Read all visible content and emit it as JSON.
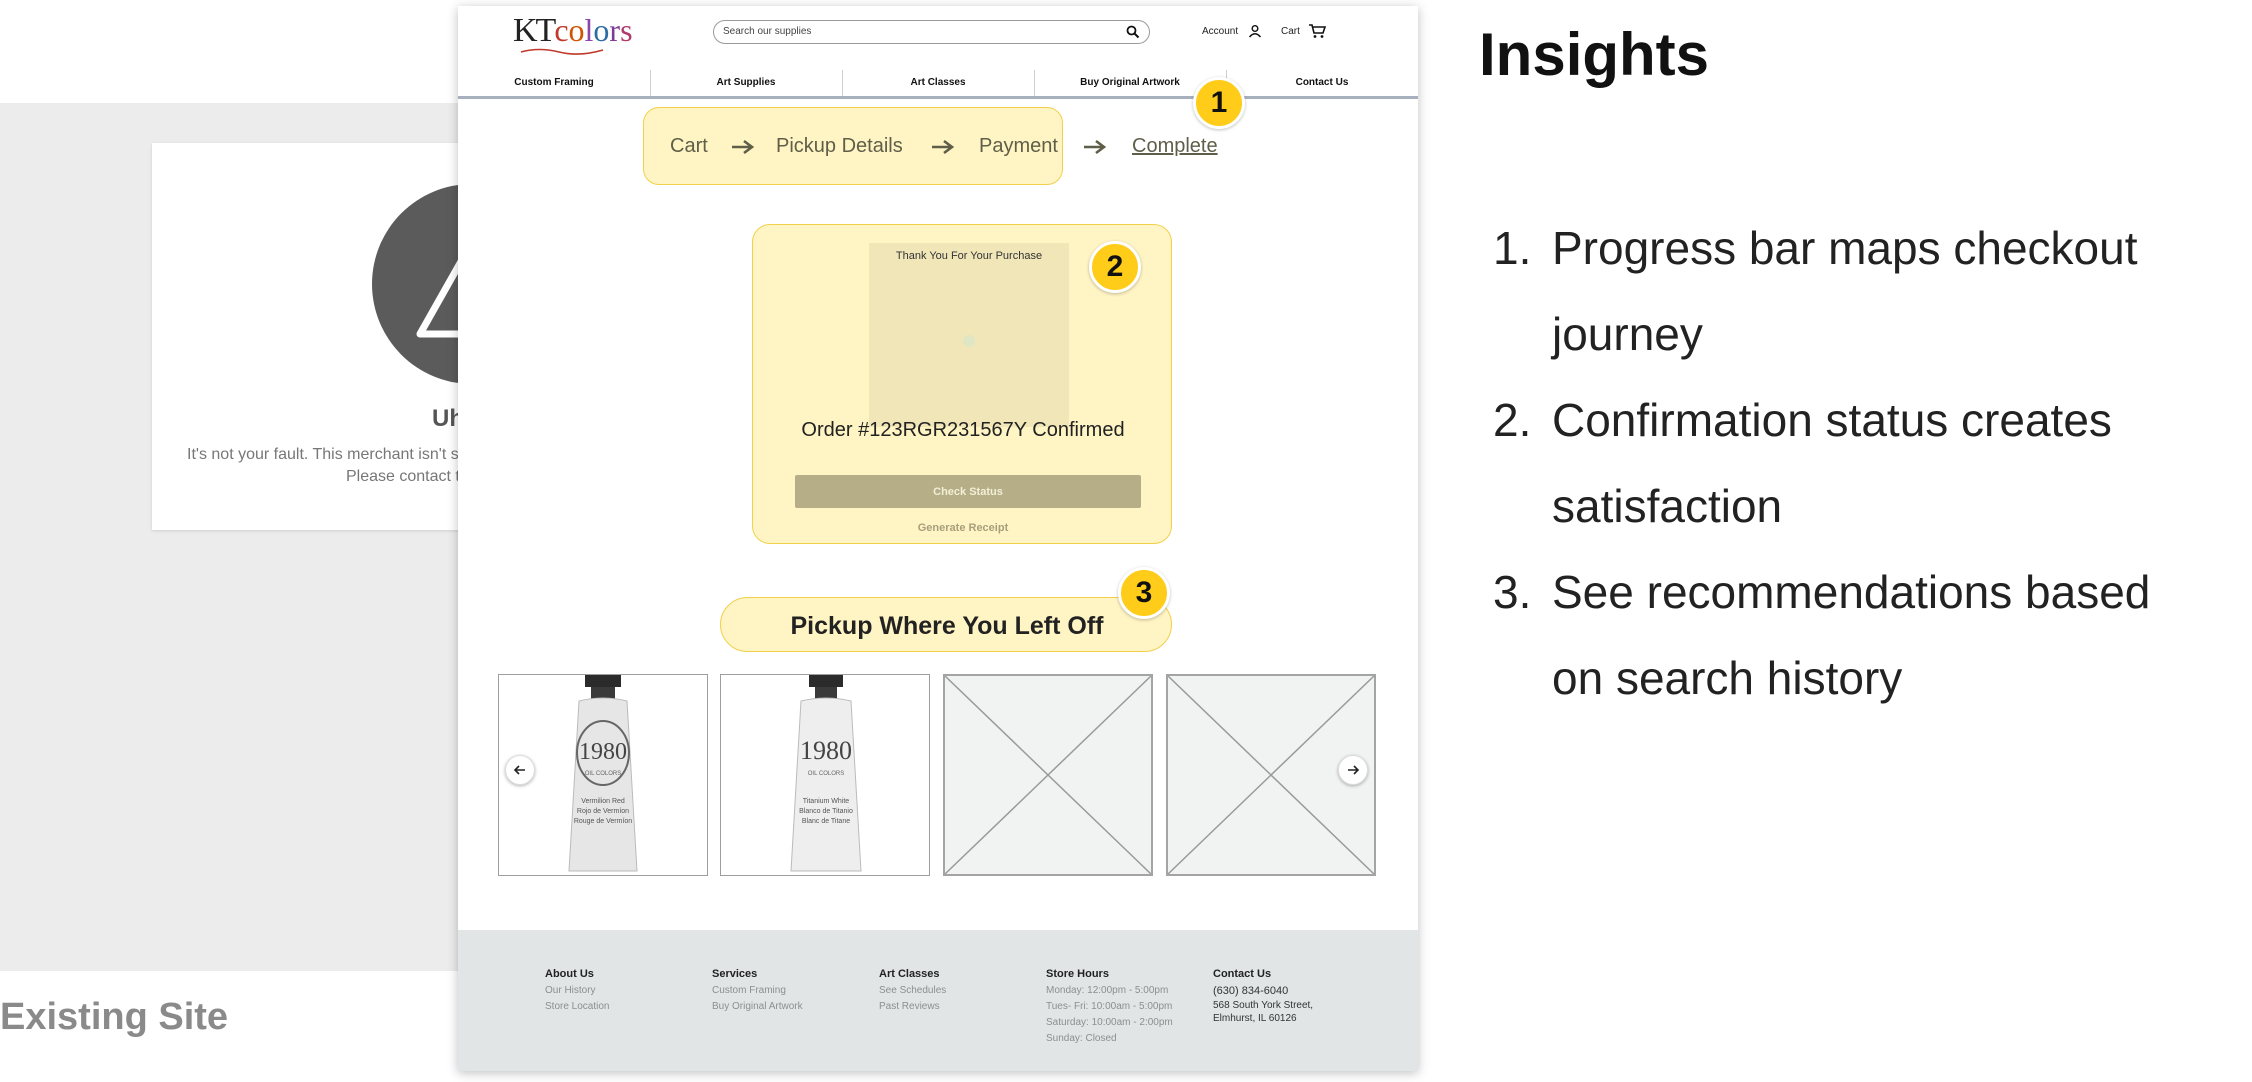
{
  "existing": {
    "title": "Uh",
    "message_line1": "It's not your fault. This merchant isn't s",
    "message_line2": "Please contact t",
    "label": "Existing Site"
  },
  "header": {
    "logo_k": "KT",
    "logo_colors": "colors",
    "search_placeholder": "Search our supplies",
    "account_label": "Account",
    "cart_label": "Cart"
  },
  "nav": {
    "items": [
      "Custom Framing",
      "Art Supplies",
      "Art Classes",
      "Buy Original Artwork",
      "Contact Us"
    ]
  },
  "progress": {
    "steps": [
      "Cart",
      "Pickup Details",
      "Payment",
      "Complete"
    ],
    "current": "Complete"
  },
  "confirmation": {
    "thanks": "Thank You For Your Purchase",
    "order": "Order #123RGR231567Y Confirmed",
    "check_status": "Check Status",
    "generate_receipt": "Generate Receipt"
  },
  "recommendations": {
    "title": "Pickup Where You Left Off",
    "products": [
      {
        "brand": "1980",
        "sub": "OIL COLORS",
        "line1": "Vermilion Red",
        "line2": "Rojo de Vermíon",
        "line3": "Rouge de Vermíon"
      },
      {
        "brand": "1980",
        "sub": "OIL COLORS",
        "line1": "Titanium White",
        "line2": "Blanco de Titanio",
        "line3": "Blanc de Titane"
      }
    ]
  },
  "footer": {
    "columns": [
      {
        "heading": "About Us",
        "items": [
          "Our History",
          "Store Location"
        ]
      },
      {
        "heading": "Services",
        "items": [
          "Custom Framing",
          "Buy Original Artwork"
        ]
      },
      {
        "heading": "Art Classes",
        "items": [
          "See Schedules",
          "Past Reviews"
        ]
      },
      {
        "heading": "Store Hours",
        "items": [
          "Monday: 12:00pm - 5:00pm",
          "Tues- Fri: 10:00am - 5:00pm",
          "Saturday:  10:00am - 2:00pm",
          "Sunday: Closed"
        ]
      },
      {
        "heading": "Contact Us",
        "phone": "(630) 834-6040",
        "address1": "568 South York Street,",
        "address2": "Elmhurst, IL 60126"
      }
    ]
  },
  "badges": [
    "1",
    "2",
    "3"
  ],
  "insights": {
    "title": "Insights",
    "items": [
      {
        "num": "1.",
        "line1": "Progress bar maps checkout",
        "line2": "journey"
      },
      {
        "num": "2.",
        "line1": "Confirmation status creates",
        "line2": "satisfaction"
      },
      {
        "num": "3.",
        "line1": "See recommendations based",
        "line2": "on search history"
      }
    ]
  },
  "colors": {
    "highlight_fill": "#fff4c4",
    "highlight_border": "#f2d04b",
    "badge": "#ffcc1a",
    "button": "#b5ae86",
    "footer_bg": "#e1e5e6",
    "existing_bg": "#ececec"
  },
  "icons": [
    "search-icon",
    "account-icon",
    "cart-icon",
    "arrow-right-icon",
    "chevron-left-icon",
    "chevron-right-icon",
    "warning-triangle-icon"
  ]
}
